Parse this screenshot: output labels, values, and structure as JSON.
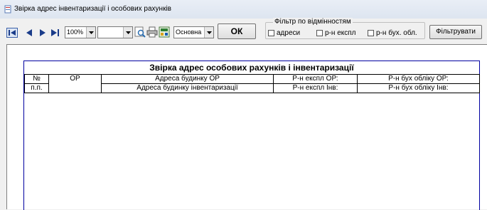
{
  "window": {
    "title": "Звірка адрес інвентаризації і особових рахунків"
  },
  "toolbar": {
    "zoom_value": "100%",
    "page_value": "",
    "report_mode_value": "Основна",
    "ok_label": "ОК",
    "icons": [
      "first-page-icon",
      "prev-page-icon",
      "next-page-icon",
      "last-page-icon",
      "find-icon",
      "print-icon",
      "export-icon"
    ]
  },
  "filter": {
    "legend": "Фільтр по відмінностям",
    "options": [
      {
        "label": "адреси",
        "checked": false
      },
      {
        "label": "р-н експл",
        "checked": false
      },
      {
        "label": "р-н бух. обл.",
        "checked": false
      }
    ],
    "button_label": "Фільтрувати"
  },
  "report": {
    "title": "Звірка адрес особових рахунків і інвентаризації",
    "header_row1": [
      "№",
      "ОР",
      "Адреса будинку ОР",
      "Р-н експл ОР:",
      "Р-н бух обліку ОР:"
    ],
    "header_row2": [
      "п.п.",
      "",
      "Адреса будинку інвентаризації",
      "Р-н експл Інв:",
      "Р-н бух обліку Інв:"
    ]
  }
}
